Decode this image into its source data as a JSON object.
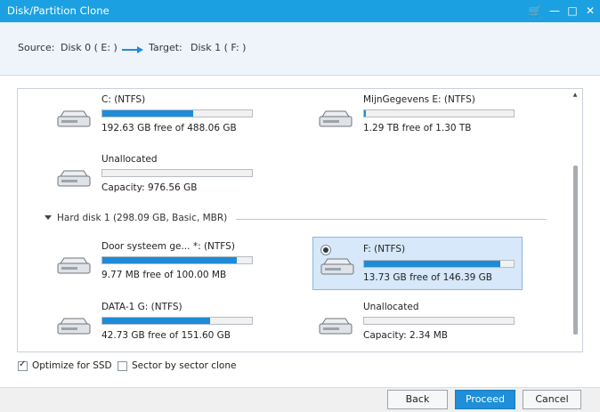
{
  "window": {
    "title": "Disk/Partition Clone",
    "controls": {
      "cart": "🛒",
      "minimize": "—",
      "maximize": "□",
      "close": "✕"
    }
  },
  "source_bar": {
    "source_label": "Source:",
    "source_value": "Disk 0 ( E: )",
    "target_label": "Target:",
    "target_value": "Disk 1 ( F: )"
  },
  "disk0": {
    "partitions": [
      {
        "name": "C: (NTFS)",
        "info": "192.63 GB free of 488.06 GB",
        "used_fraction": 0.61
      },
      {
        "name": "MijnGegevens E: (NTFS)",
        "info": "1.29 TB free of 1.30 TB",
        "used_fraction": 0.01
      },
      {
        "name": "Unallocated",
        "info": "Capacity: 976.56 GB",
        "used_fraction": 0.0
      }
    ]
  },
  "disk1": {
    "header": "Hard disk 1 (298.09 GB, Basic, MBR)",
    "partitions": [
      {
        "name": "Door systeem ge... *: (NTFS)",
        "info": "9.77 MB free of 100.00 MB",
        "used_fraction": 0.9
      },
      {
        "name": "F: (NTFS)",
        "info": "13.73 GB free of 146.39 GB",
        "used_fraction": 0.91,
        "selected": true
      },
      {
        "name": "DATA-1 G: (NTFS)",
        "info": "42.73 GB free of 151.60 GB",
        "used_fraction": 0.72
      },
      {
        "name": "Unallocated",
        "info": "Capacity: 2.34 MB",
        "used_fraction": 0.0
      }
    ]
  },
  "options": {
    "optimize_ssd": {
      "label": "Optimize for SSD",
      "checked": true
    },
    "sector_clone": {
      "label": "Sector by sector clone",
      "checked": false
    }
  },
  "footer": {
    "back": "Back",
    "proceed": "Proceed",
    "cancel": "Cancel"
  },
  "colors": {
    "titlebar": "#1ba1e2",
    "bar_fill": "#1e8bd8",
    "selected_bg": "#d6e8fa",
    "primary_button": "#1e8fd8"
  }
}
